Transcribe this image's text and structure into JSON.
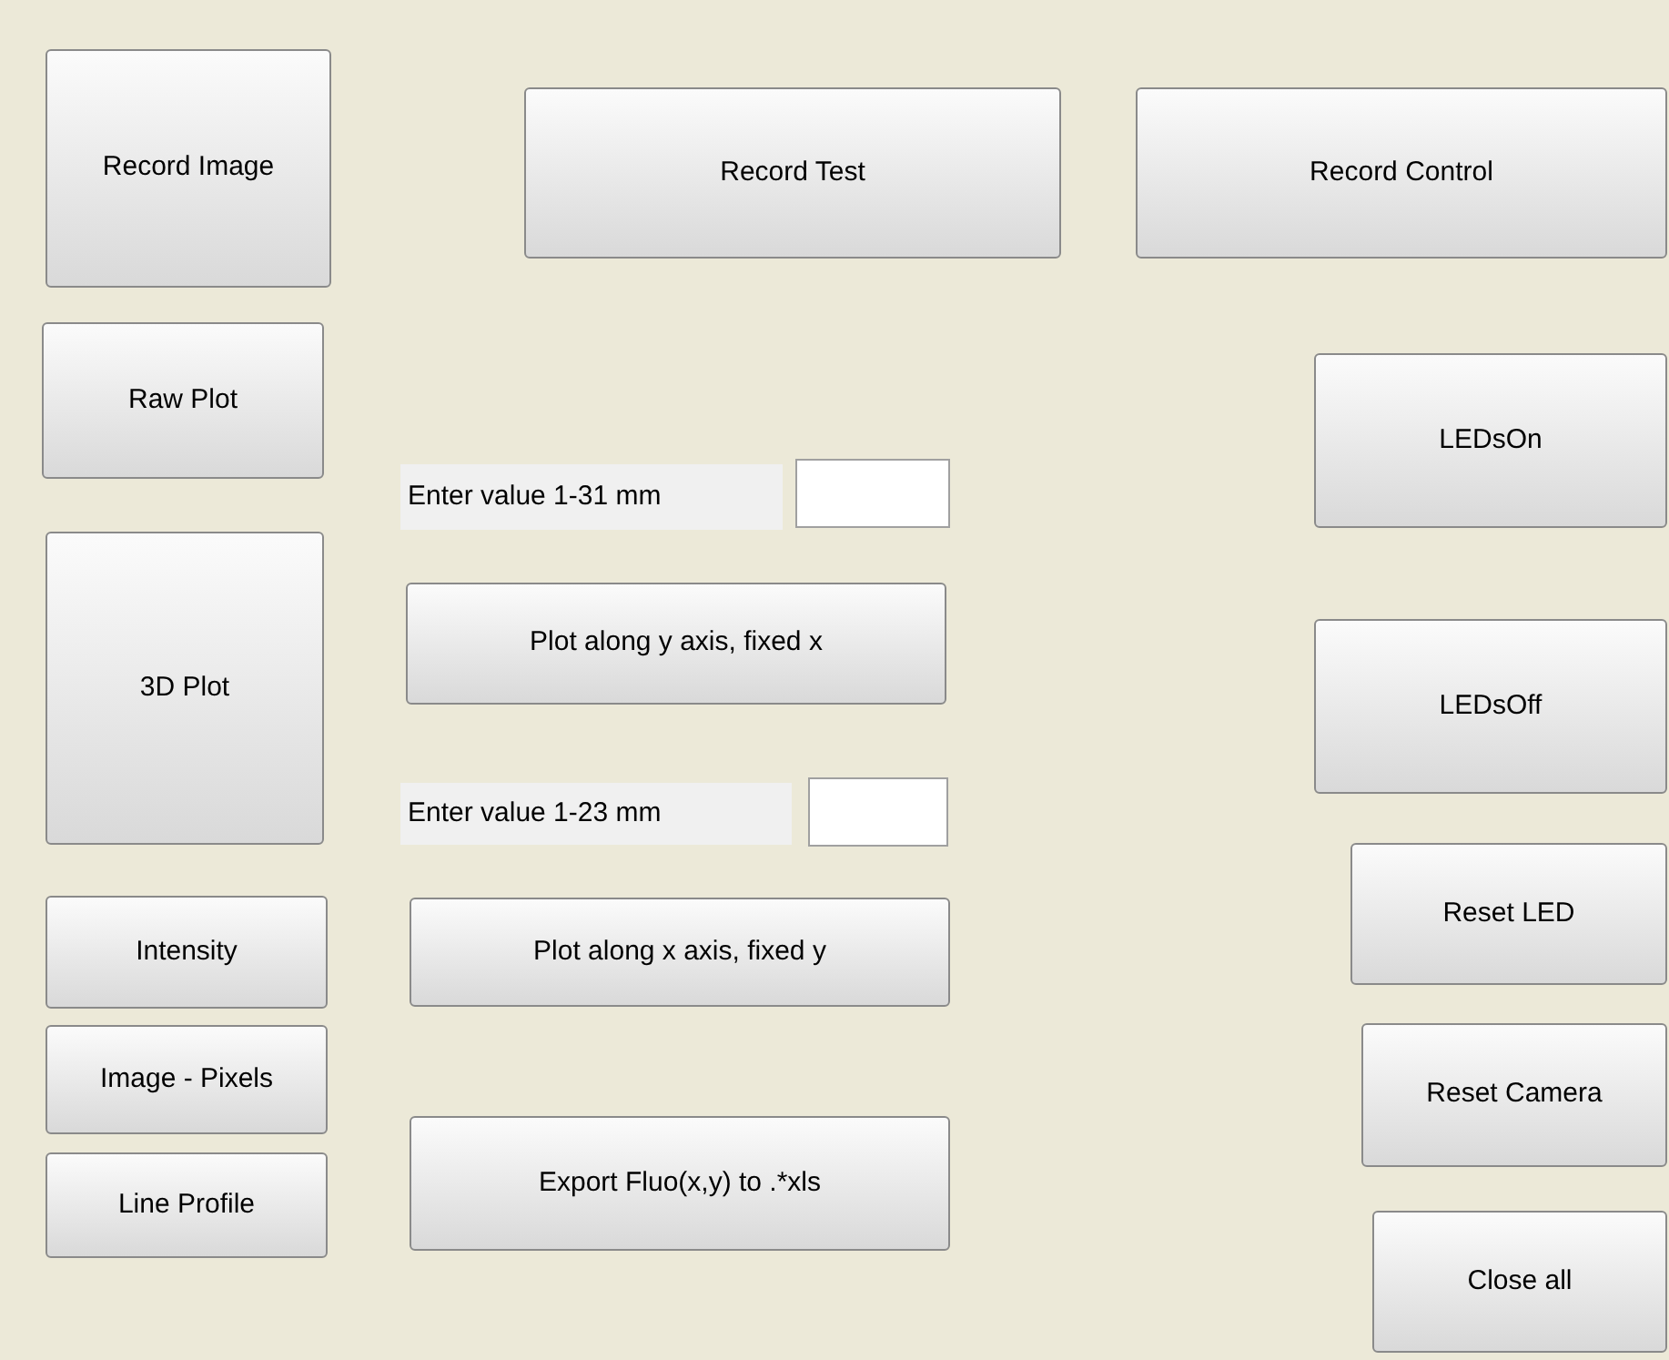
{
  "controls": [
    {
      "kind": "button",
      "label": "Record Image"
    },
    {
      "kind": "button",
      "label": "Record Test"
    },
    {
      "kind": "button",
      "label": "Record Control"
    },
    {
      "kind": "button",
      "label": "Raw Plot"
    },
    {
      "kind": "label",
      "label": "Enter value 1-31 mm"
    },
    {
      "kind": "field"
    },
    {
      "kind": "button",
      "label": "LEDsOn"
    },
    {
      "kind": "button",
      "label": "3D Plot"
    },
    {
      "kind": "button",
      "label": "Plot along y axis, fixed x"
    },
    {
      "kind": "button",
      "label": "LEDsOff"
    },
    {
      "kind": "label",
      "label": "Enter value 1-23 mm"
    },
    {
      "kind": "field"
    },
    {
      "kind": "button",
      "label": "Reset LED"
    },
    {
      "kind": "button",
      "label": "Intensity"
    },
    {
      "kind": "button",
      "label": "Plot along x axis, fixed y"
    },
    {
      "kind": "button",
      "label": "Reset Camera"
    },
    {
      "kind": "button",
      "label": "Image - Pixels"
    },
    {
      "kind": "button",
      "label": "Export Fluo(x,y) to .*xls"
    },
    {
      "kind": "button",
      "label": "Line Profile"
    },
    {
      "kind": "button",
      "label": "Close all"
    }
  ]
}
